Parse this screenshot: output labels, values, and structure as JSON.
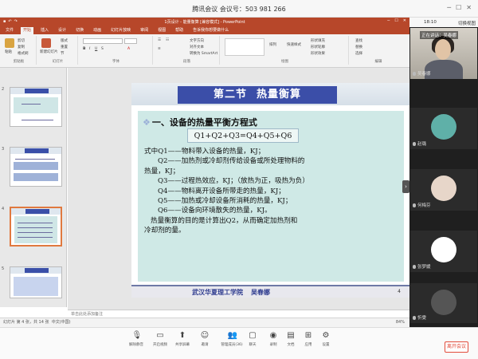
{
  "meeting": {
    "title": "腾讯会议 会议号：503 981 266",
    "time": "18:10",
    "switch_view": "切换视图"
  },
  "ppt": {
    "window_title": "1页设计 - 能量衡算 [兼容模式] - PowerPoint",
    "tabs": [
      "文件",
      "开始",
      "插入",
      "设计",
      "切换",
      "动画",
      "幻灯片放映",
      "审阅",
      "视图",
      "帮助"
    ],
    "tell_me": "告诉我你想要做什么",
    "ribbon": {
      "paste": "粘贴",
      "cut": "剪切",
      "copy": "复制",
      "format_painter": "格式刷",
      "clipboard": "剪贴板",
      "new_slide": "新建幻灯片",
      "layout": "版式",
      "reset": "重置",
      "section": "节",
      "slides": "幻灯片",
      "font": "字体",
      "paragraph": "段落",
      "text_direction": "文字方向",
      "align_text": "对齐文本",
      "smartart": "转换为 SmartArt",
      "drawing": "绘图",
      "arrange": "排列",
      "quick_styles": "快速样式",
      "shape_fill": "形状填充",
      "shape_outline": "形状轮廓",
      "shape_effects": "形状效果",
      "find": "查找",
      "replace": "替换",
      "select": "选择",
      "editing": "编辑"
    },
    "thumb_numbers": [
      "2",
      "3",
      "4",
      "5"
    ],
    "notes_placeholder": "单击此处添加备注",
    "status_left": "幻灯片 第 4 张，共 14 张",
    "status_lang": "中文(中国)",
    "zoom": "84%"
  },
  "slide": {
    "section": "第二节",
    "title": "热量衡算",
    "heading": "一、设备的热量平衡方程式",
    "formula": "Q1+Q2+Q3=Q4+Q5+Q6",
    "lines": [
      "式中Q1——物料带入设备的热量，KJ；",
      "Q2——加热剂或冷却剂传给设备或所处理物料的",
      "热量，KJ；",
      "Q3——过程热效应，KJ；（放热为正，吸热为负）",
      "Q4——物料离开设备所带走的热量，KJ；",
      "Q5——加热或冷却设备所消耗的热量，KJ；",
      "Q6——设备向环境散失的热量，KJ。",
      "热量衡算的目的是计算出Q2，从而确定加热剂和",
      "冷却剂的量。"
    ],
    "footer_school": "武汉华夏理工学院",
    "footer_author": "吴春娜",
    "page": "4"
  },
  "participants": {
    "speaking_label": "正在讲话：吴春娜",
    "self_name": "吴春娜",
    "others": [
      {
        "name": "赵璐",
        "color": "#5fb0a8"
      },
      {
        "name": "何梅芬",
        "color": "#e7d6c9"
      },
      {
        "name": "张梦媛",
        "color": "#ffffff"
      },
      {
        "name": "忻雯",
        "color": "#555555"
      }
    ]
  },
  "toolbar": {
    "items": [
      "解除静音",
      "开启视频",
      "共享屏幕",
      "邀请",
      "管理成员(36)",
      "聊天",
      "录制",
      "文档",
      "应用",
      "设置"
    ],
    "leave": "离开会议"
  },
  "colors": {
    "ppt_accent": "#b7472a",
    "slide_title_bg": "#3b4ea8",
    "slide_body_bg": "#cfe9e6",
    "leave_red": "#e24b3b"
  }
}
